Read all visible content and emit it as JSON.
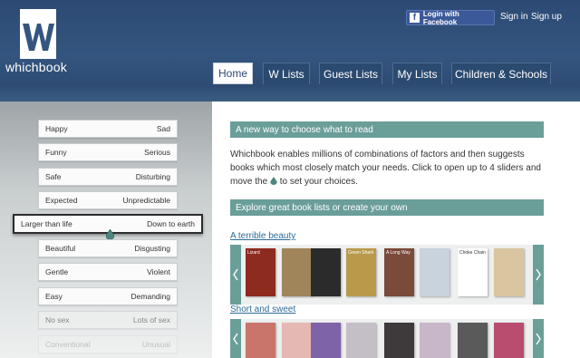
{
  "brand": {
    "name": "whichbook"
  },
  "header": {
    "facebook_login": "Login with Facebook",
    "sign_in": "Sign in",
    "sign_up": "Sign up"
  },
  "nav": {
    "tabs": [
      {
        "label": "Home",
        "active": true
      },
      {
        "label": "W Lists"
      },
      {
        "label": "Guest Lists"
      },
      {
        "label": "My Lists"
      },
      {
        "label": "Children & Schools"
      }
    ]
  },
  "sliders": [
    {
      "left": "Happy",
      "right": "Sad"
    },
    {
      "left": "Funny",
      "right": "Serious"
    },
    {
      "left": "Safe",
      "right": "Disturbing"
    },
    {
      "left": "Expected",
      "right": "Unpredictable"
    },
    {
      "left": "Larger than life",
      "right": "Down to earth",
      "active": true
    },
    {
      "left": "Beautiful",
      "right": "Disgusting"
    },
    {
      "left": "Gentle",
      "right": "Violent"
    },
    {
      "left": "Easy",
      "right": "Demanding"
    },
    {
      "left": "No sex",
      "right": "Lots of sex"
    },
    {
      "left": "Conventional",
      "right": "Unusual"
    }
  ],
  "main": {
    "intro_heading": "A new way to choose what to read",
    "intro_text_1": "Whichbook enables millions of combinations of factors and then suggests books which most closely match your needs. Click to open up to 4 sliders and move the",
    "intro_text_2": "to set your choices.",
    "explore_heading": "Explore great book lists or create your own",
    "lists": [
      {
        "title": "A terrible beauty"
      },
      {
        "title": "Short and sweet"
      }
    ]
  },
  "book_covers_row1": [
    {
      "text": "Lizard",
      "color": "#8d2b1f"
    },
    {
      "text": "",
      "color": "#a0855a"
    },
    {
      "text": "",
      "color": "#2b2b2b"
    },
    {
      "text": "Green Shark",
      "color": "#b99a4b"
    },
    {
      "text": "A Long Way",
      "color": "#7a4a3a"
    },
    {
      "text": "",
      "color": "#c9d3dd"
    },
    {
      "text": "Choke Chain",
      "color": "#ffffff"
    },
    {
      "text": "",
      "color": "#d9c6a0"
    }
  ],
  "book_covers_row2": [
    {
      "color": "#c9756b"
    },
    {
      "color": "#e6b8b4"
    },
    {
      "color": "#7f63a8"
    },
    {
      "color": "#c4bfc6"
    },
    {
      "color": "#3e3a3c"
    },
    {
      "color": "#c8b6c9"
    },
    {
      "color": "#5a5a5a"
    },
    {
      "color": "#b84d6f"
    }
  ]
}
